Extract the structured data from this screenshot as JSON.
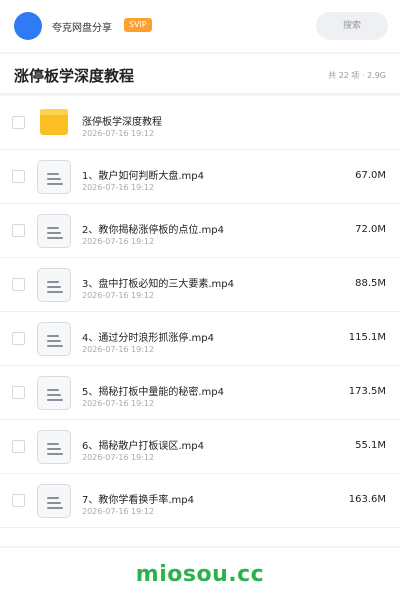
{
  "header": {
    "username": "夸克网盘分享",
    "badge": "SVIP",
    "search_placeholder": "搜索"
  },
  "folder": {
    "title": "涨停板学深度教程",
    "summary": "共 22 项 · 2.9G"
  },
  "items": [
    {
      "type": "folder",
      "name": "涨停板学深度教程",
      "date": "2026-07-16 19:12",
      "size": ""
    },
    {
      "type": "file",
      "name": "1、散户如何判断大盘.mp4",
      "date": "2026-07-16 19:12",
      "size": "67.0M"
    },
    {
      "type": "file",
      "name": "2、教你揭秘涨停板的点位.mp4",
      "date": "2026-07-16 19:12",
      "size": "72.0M"
    },
    {
      "type": "file",
      "name": "3、盘中打板必知的三大要素.mp4",
      "date": "2026-07-16 19:12",
      "size": "88.5M"
    },
    {
      "type": "file",
      "name": "4、通过分时浪形抓涨停.mp4",
      "date": "2026-07-16 19:12",
      "size": "115.1M"
    },
    {
      "type": "file",
      "name": "5、揭秘打板中量能的秘密.mp4",
      "date": "2026-07-16 19:12",
      "size": "173.5M"
    },
    {
      "type": "file",
      "name": "6、揭秘散户打板误区.mp4",
      "date": "2026-07-16 19:12",
      "size": "55.1M"
    },
    {
      "type": "file",
      "name": "7、教你学看换手率.mp4",
      "date": "2026-07-16 19:12",
      "size": "163.6M"
    }
  ],
  "watermark": "miosou.cc",
  "colors": {
    "avatar": "#2f7bf5",
    "badge": "#ff9f2d",
    "folder": "#fbbf24",
    "watermark": "#2bb24c"
  }
}
